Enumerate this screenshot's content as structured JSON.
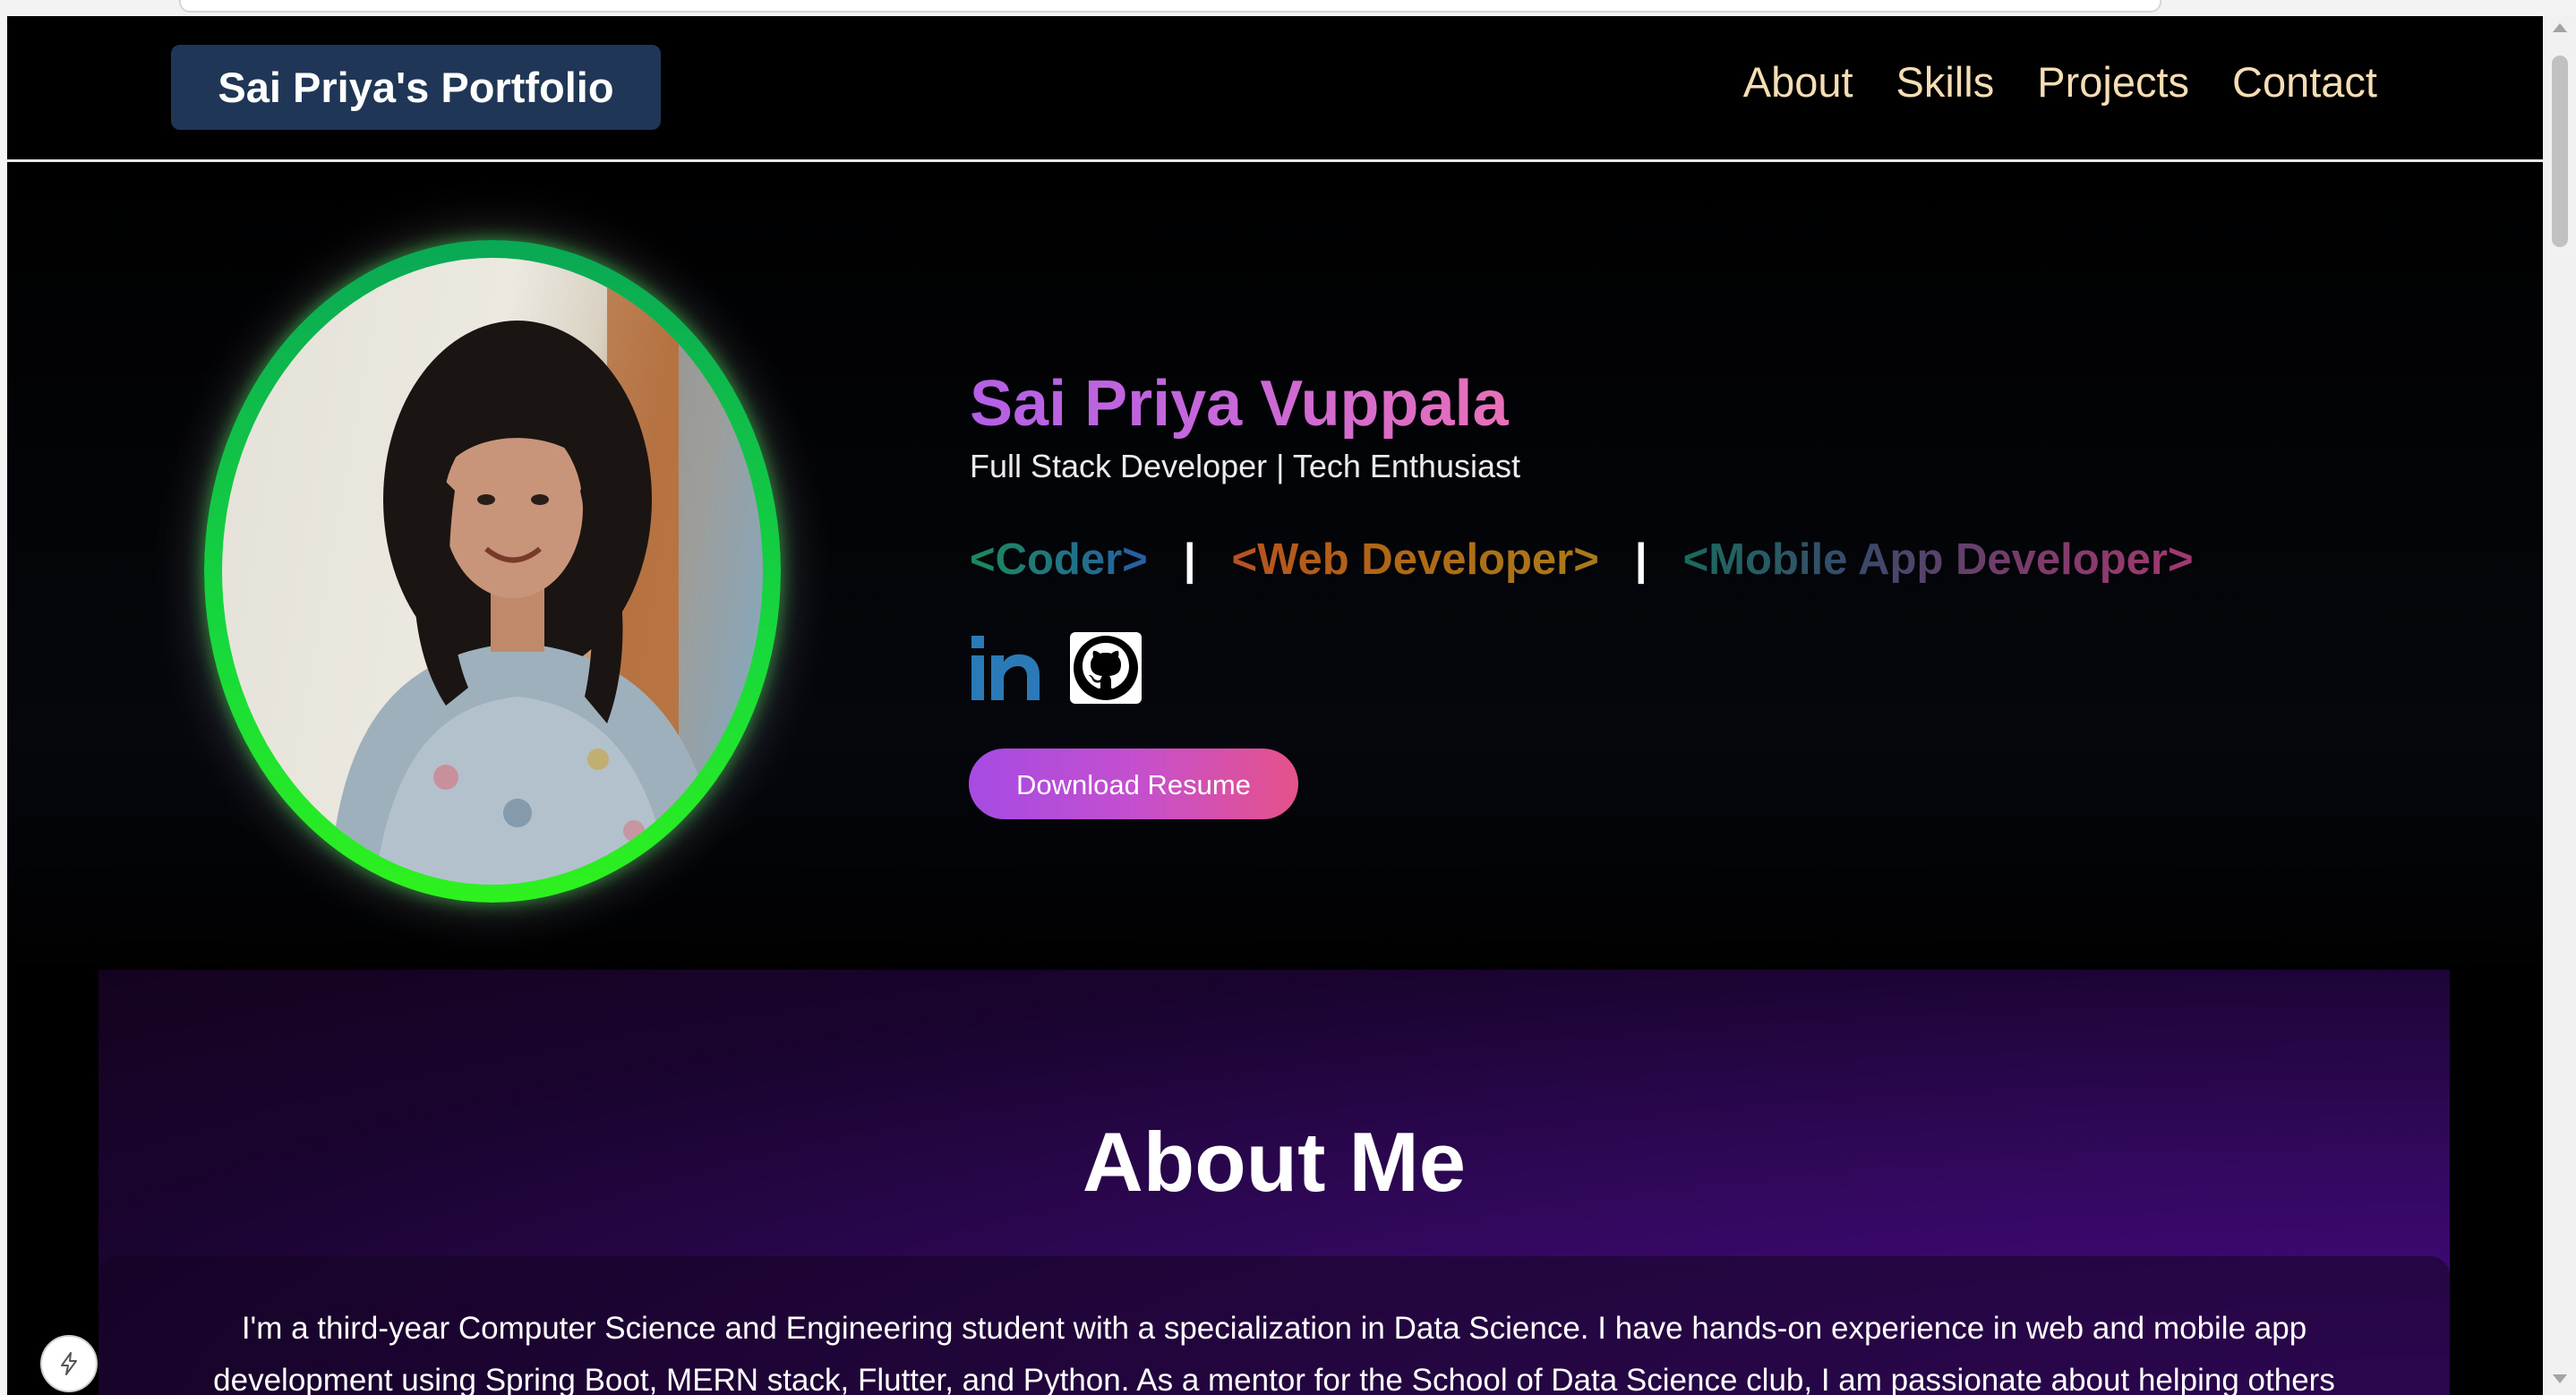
{
  "navbar": {
    "brand": "Sai Priya's Portfolio",
    "links": [
      "About",
      "Skills",
      "Projects",
      "Contact"
    ]
  },
  "hero": {
    "name": "Sai Priya Vuppala",
    "subtitle": "Full Stack Developer | Tech Enthusiast",
    "roles": [
      "<Coder>",
      "<Web Developer>",
      "<Mobile App Developer>"
    ],
    "role_separator": "|",
    "social": [
      {
        "name": "LinkedIn",
        "icon": "linkedin-icon"
      },
      {
        "name": "GitHub",
        "icon": "github-icon"
      }
    ],
    "resume_button": "Download Resume"
  },
  "about": {
    "title": "About Me",
    "text": "I'm a third-year Computer Science and Engineering student with a specialization in Data Science. I have hands-on experience in web and mobile app development using Spring Boot, MERN stack, Flutter, and Python. As a mentor for the School of Data Science club, I am passionate about helping others"
  },
  "colors": {
    "page_background": "#000000",
    "brand_background": "#1f3656",
    "nav_link": "#f5deb3",
    "photo_ring": "#17d83c",
    "resume_gradient_start": "#a64be3",
    "resume_gradient_end": "#e6528a",
    "about_background": "#33085f"
  }
}
